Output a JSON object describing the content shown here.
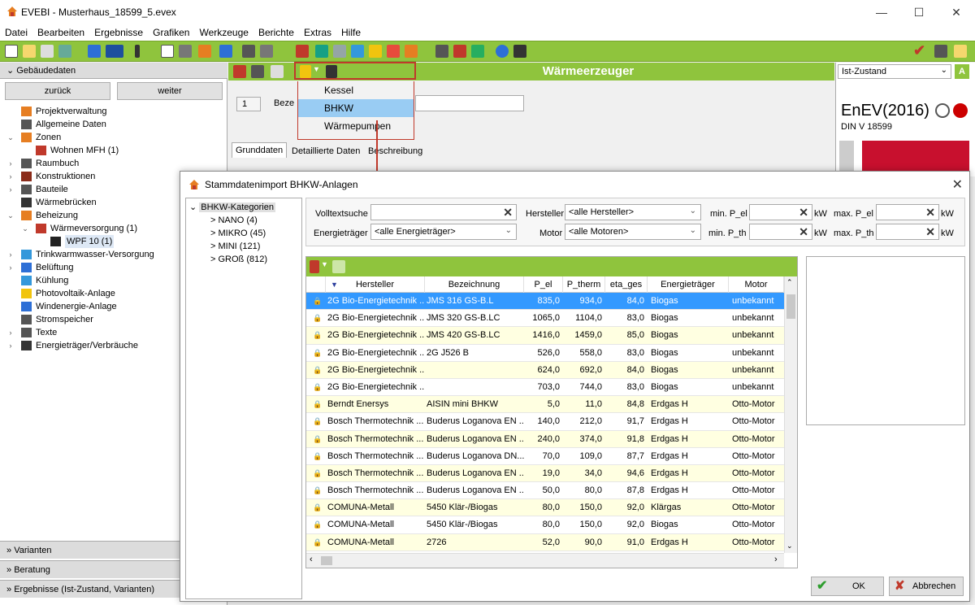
{
  "window": {
    "title": "EVEBI - Musterhaus_18599_5.evex",
    "controls": {
      "minimize": "—",
      "maximize": "☐",
      "close": "✕"
    }
  },
  "menu": [
    "Datei",
    "Bearbeiten",
    "Ergebnisse",
    "Grafiken",
    "Werkzeuge",
    "Berichte",
    "Extras",
    "Hilfe"
  ],
  "colors": {
    "accent_green": "#8fc43d",
    "selection_blue": "#3399ff",
    "alt_row": "#ffffe1",
    "highlight_red": "#c0392b"
  },
  "left_panel": {
    "header": "Gebäudedaten",
    "back_label": "zurück",
    "forward_label": "weiter",
    "tree": [
      {
        "label": "Projektverwaltung",
        "level": 0,
        "expander": "",
        "icon": "project-icon"
      },
      {
        "label": "Allgemeine Daten",
        "level": 0,
        "expander": "",
        "icon": "house-data-icon"
      },
      {
        "label": "Zonen",
        "level": 0,
        "expander": "v",
        "icon": "zones-icon"
      },
      {
        "label": "Wohnen MFH (1)",
        "level": 1,
        "expander": "",
        "icon": "house-icon"
      },
      {
        "label": "Raumbuch",
        "level": 0,
        "expander": ">",
        "icon": "roombook-icon"
      },
      {
        "label": "Konstruktionen",
        "level": 0,
        "expander": ">",
        "icon": "construction-icon"
      },
      {
        "label": "Bauteile",
        "level": 0,
        "expander": ">",
        "icon": "component-icon"
      },
      {
        "label": "Wärmebrücken",
        "level": 0,
        "expander": "",
        "icon": "thermal-bridge-icon"
      },
      {
        "label": "Beheizung",
        "level": 0,
        "expander": "v",
        "icon": "heating-icon"
      },
      {
        "label": "Wärmeversorgung (1)",
        "level": 1,
        "expander": "v",
        "icon": "heat-supply-icon"
      },
      {
        "label": "WPF 10  (1)",
        "level": 2,
        "expander": "",
        "icon": "heatpump-icon"
      },
      {
        "label": "Trinkwarmwasser-Versorgung",
        "level": 0,
        "expander": ">",
        "icon": "water-icon"
      },
      {
        "label": "Belüftung",
        "level": 0,
        "expander": ">",
        "icon": "ventilation-icon"
      },
      {
        "label": "Kühlung",
        "level": 0,
        "expander": "",
        "icon": "cooling-icon"
      },
      {
        "label": "Photovoltaik-Anlage",
        "level": 0,
        "expander": "",
        "icon": "pv-icon"
      },
      {
        "label": "Windenergie-Anlage",
        "level": 0,
        "expander": "",
        "icon": "wind-icon"
      },
      {
        "label": "Stromspeicher",
        "level": 0,
        "expander": "",
        "icon": "battery-icon"
      },
      {
        "label": "Texte",
        "level": 0,
        "expander": ">",
        "icon": "text-icon"
      },
      {
        "label": "Energieträger/Verbräuche",
        "level": 0,
        "expander": ">",
        "icon": "energy-icon"
      }
    ],
    "bottom": [
      "Varianten",
      "Beratung",
      "Ergebnisse (Ist-Zustand, Varianten)"
    ]
  },
  "main": {
    "title": "Wärmeerzeuger",
    "number": "1",
    "bez_label": "Beze",
    "tabs": [
      "Grunddaten",
      "Detaillierte Daten",
      "Beschreibung"
    ],
    "dropdown_menu": [
      "Kessel",
      "BHKW",
      "Wärmepumpen"
    ],
    "dropdown_selected": "BHKW"
  },
  "right_panel": {
    "variant": "Ist-Zustand",
    "variant_button": "A",
    "enev": "EnEV(2016)",
    "din": "DIN V 18599"
  },
  "dialog": {
    "title": "Stammdatenimport BHKW-Anlagen",
    "categories_root": "BHKW-Kategorien",
    "categories": [
      "NANO (4)",
      "MIKRO (45)",
      "MINI (121)",
      "GROß (812)"
    ],
    "filters": {
      "volltext_label": "Volltextsuche",
      "volltext_value": "",
      "hersteller_label": "Hersteller",
      "hersteller_value": "<alle Hersteller>",
      "min_pel_label": "min. P_el",
      "max_pel_label": "max. P_el",
      "energietraeger_label": "Energieträger",
      "energietraeger_value": "<alle Energieträger>",
      "motor_label": "Motor",
      "motor_value": "<alle Motoren>",
      "min_pth_label": "min. P_th",
      "max_pth_label": "max. P_th",
      "unit": "kW"
    },
    "columns": [
      "Hersteller",
      "Bezeichnung",
      "P_el",
      "P_therm",
      "eta_ges",
      "Energieträger",
      "Motor"
    ],
    "rows": [
      {
        "hersteller": "2G Bio-Energietechnik ...",
        "bezeichnung": "JMS 316 GS-B.L",
        "pel": "835,0",
        "ptherm": "934,0",
        "eta": "84,0",
        "et": "Biogas",
        "motor": "unbekannt"
      },
      {
        "hersteller": "2G Bio-Energietechnik ...",
        "bezeichnung": "JMS 320 GS-B.LC",
        "pel": "1065,0",
        "ptherm": "1104,0",
        "eta": "83,0",
        "et": "Biogas",
        "motor": "unbekannt"
      },
      {
        "hersteller": "2G Bio-Energietechnik ...",
        "bezeichnung": "JMS 420 GS-B.LC",
        "pel": "1416,0",
        "ptherm": "1459,0",
        "eta": "85,0",
        "et": "Biogas",
        "motor": "unbekannt"
      },
      {
        "hersteller": "2G Bio-Energietechnik ...",
        "bezeichnung": "2G J526 B",
        "pel": "526,0",
        "ptherm": "558,0",
        "eta": "83,0",
        "et": "Biogas",
        "motor": "unbekannt"
      },
      {
        "hersteller": "2G Bio-Energietechnik ...",
        "bezeichnung": "",
        "pel": "624,0",
        "ptherm": "692,0",
        "eta": "84,0",
        "et": "Biogas",
        "motor": "unbekannt"
      },
      {
        "hersteller": "2G Bio-Energietechnik ...",
        "bezeichnung": "",
        "pel": "703,0",
        "ptherm": "744,0",
        "eta": "83,0",
        "et": "Biogas",
        "motor": "unbekannt"
      },
      {
        "hersteller": "Berndt Enersys",
        "bezeichnung": "AISIN  mini BHKW",
        "pel": "5,0",
        "ptherm": "11,0",
        "eta": "84,8",
        "et": "Erdgas H",
        "motor": "Otto-Motor"
      },
      {
        "hersteller": "Bosch Thermotechnik ...",
        "bezeichnung": "Buderus Loganova EN ...",
        "pel": "140,0",
        "ptherm": "212,0",
        "eta": "91,7",
        "et": "Erdgas H",
        "motor": "Otto-Motor"
      },
      {
        "hersteller": "Bosch Thermotechnik ...",
        "bezeichnung": "Buderus Loganova EN ...",
        "pel": "240,0",
        "ptherm": "374,0",
        "eta": "91,8",
        "et": "Erdgas H",
        "motor": "Otto-Motor"
      },
      {
        "hersteller": "Bosch Thermotechnik ...",
        "bezeichnung": "Buderus Loganova DN...",
        "pel": "70,0",
        "ptherm": "109,0",
        "eta": "87,7",
        "et": "Erdgas H",
        "motor": "Otto-Motor"
      },
      {
        "hersteller": "Bosch Thermotechnik ...",
        "bezeichnung": "Buderus Loganova EN ...",
        "pel": "19,0",
        "ptherm": "34,0",
        "eta": "94,6",
        "et": "Erdgas H",
        "motor": "Otto-Motor"
      },
      {
        "hersteller": "Bosch Thermotechnik ...",
        "bezeichnung": "Buderus Loganova EN ...",
        "pel": "50,0",
        "ptherm": "80,0",
        "eta": "87,8",
        "et": "Erdgas H",
        "motor": "Otto-Motor"
      },
      {
        "hersteller": "COMUNA-Metall",
        "bezeichnung": "5450 Klär-/Biogas",
        "pel": "80,0",
        "ptherm": "150,0",
        "eta": "92,0",
        "et": "Klärgas",
        "motor": "Otto-Motor"
      },
      {
        "hersteller": "COMUNA-Metall",
        "bezeichnung": "5450 Klär-/Biogas",
        "pel": "80,0",
        "ptherm": "150,0",
        "eta": "92,0",
        "et": "Biogas",
        "motor": "Otto-Motor"
      },
      {
        "hersteller": "COMUNA-Metall",
        "bezeichnung": "2726",
        "pel": "52,0",
        "ptherm": "90,0",
        "eta": "91,0",
        "et": "Erdgas H",
        "motor": "Otto-Motor"
      }
    ],
    "ok_label": "OK",
    "cancel_label": "Abbrechen"
  }
}
